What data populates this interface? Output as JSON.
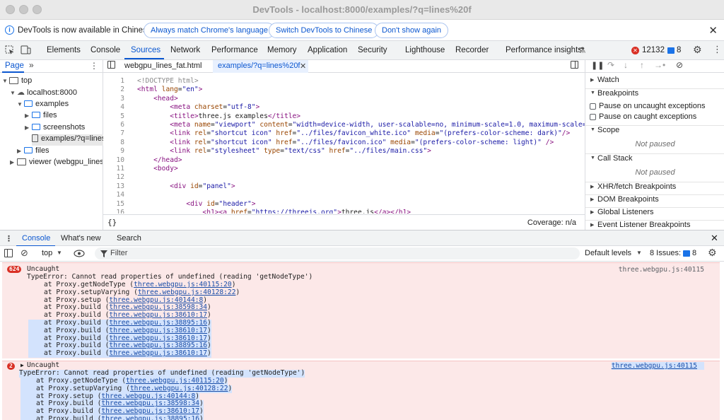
{
  "window": {
    "title": "DevTools - localhost:8000/examples/?q=lines%20f"
  },
  "infobar": {
    "message": "DevTools is now available in Chinese!",
    "btn_match": "Always match Chrome's language",
    "btn_switch": "Switch DevTools to Chinese",
    "btn_dont": "Don't show again",
    "close": "✕"
  },
  "tabs": {
    "elements": "Elements",
    "console": "Console",
    "sources": "Sources",
    "network": "Network",
    "performance": "Performance",
    "memory": "Memory",
    "application": "Application",
    "security": "Security",
    "lighthouse": "Lighthouse",
    "recorder": "Recorder",
    "perf_insights": "Performance insights",
    "error_count": "12132",
    "message_count": "8"
  },
  "navigator": {
    "tab_page": "Page",
    "items": [
      {
        "label": "top"
      },
      {
        "label": "localhost:8000"
      },
      {
        "label": "examples"
      },
      {
        "label": "files"
      },
      {
        "label": "screenshots"
      },
      {
        "label": "examples/?q=lines%20fat"
      },
      {
        "label": "files"
      },
      {
        "label": "viewer (webgpu_lines_fat.html)"
      }
    ]
  },
  "editor": {
    "tab1": "webgpu_lines_fat.html",
    "tab2": "examples/?q=lines%20f",
    "coverage": "Coverage: n/a",
    "format": "{}",
    "lines": [
      "<!DOCTYPE html>",
      "<html lang=\"en\">",
      "    <head>",
      "        <meta charset=\"utf-8\">",
      "        <title>three.js examples</title>",
      "        <meta name=\"viewport\" content=\"width=device-width, user-scalable=no, minimum-scale=1.0, maximum-scale=1.0\">",
      "        <link rel=\"shortcut icon\" href=\"../files/favicon_white.ico\" media=\"(prefers-color-scheme: dark)\"/>",
      "        <link rel=\"shortcut icon\" href=\"../files/favicon.ico\" media=\"(prefers-color-scheme: light)\" />",
      "        <link rel=\"stylesheet\" type=\"text/css\" href=\"../files/main.css\">",
      "    </head>",
      "    <body>",
      "",
      "        <div id=\"panel\">",
      "",
      "            <div id=\"header\">",
      "                <h1><a href=\"https://threejs.org\">three.js</a></h1>"
    ]
  },
  "debugger": {
    "watch": "Watch",
    "breakpoints": "Breakpoints",
    "pause_uncaught": "Pause on uncaught exceptions",
    "pause_caught": "Pause on caught exceptions",
    "scope": "Scope",
    "not_paused": "Not paused",
    "call_stack": "Call Stack",
    "not_paused2": "Not paused",
    "xhr": "XHR/fetch Breakpoints",
    "dom": "DOM Breakpoints",
    "global": "Global Listeners",
    "event": "Event Listener Breakpoints"
  },
  "drawer": {
    "console": "Console",
    "whats_new": "What's new",
    "search": "Search",
    "context": "top",
    "filter_placeholder": "Filter",
    "levels": "Default levels",
    "issues": "8 Issues:",
    "issues_count": "8"
  },
  "console": {
    "entries": [
      {
        "count": "624",
        "title": "Uncaught",
        "source": "three.webgpu.js:40115",
        "error": "TypeError: Cannot read properties of undefined (reading 'getNodeType')",
        "frames": [
          {
            "fn": "at Proxy.getNodeType (",
            "link": "three.webgpu.js:40115:20",
            "end": ")"
          },
          {
            "fn": "at Proxy.setupVarying (",
            "link": "three.webgpu.js:40128:22",
            "end": ")"
          },
          {
            "fn": "at Proxy.setup (",
            "link": "three.webgpu.js:40144:8",
            "end": ")"
          },
          {
            "fn": "at Proxy.build (",
            "link": "three.webgpu.js:38598:34",
            "end": ")"
          },
          {
            "fn": "at Proxy.build (",
            "link": "three.webgpu.js:38610:17",
            "end": ")"
          },
          {
            "fn": "at Proxy.build (",
            "link": "three.webgpu.js:38895:16",
            "end": ")"
          },
          {
            "fn": "at Proxy.build (",
            "link": "three.webgpu.js:38610:17",
            "end": ")"
          },
          {
            "fn": "at Proxy.build (",
            "link": "three.webgpu.js:38610:17",
            "end": ")"
          },
          {
            "fn": "at Proxy.build (",
            "link": "three.webgpu.js:38895:16",
            "end": ")"
          },
          {
            "fn": "at Proxy.build (",
            "link": "three.webgpu.js:38610:17",
            "end": ")"
          }
        ]
      },
      {
        "count": "2",
        "title": "Uncaught",
        "source": "three.webgpu.js:40115",
        "error": "TypeError: Cannot read properties of undefined (reading 'getNodeType')",
        "frames": [
          {
            "fn": "at Proxy.getNodeType (",
            "link": "three.webgpu.js:40115:20",
            "end": ")"
          },
          {
            "fn": "at Proxy.setupVarying (",
            "link": "three.webgpu.js:40128:22",
            "end": ")"
          },
          {
            "fn": "at Proxy.setup (",
            "link": "three.webgpu.js:40144:8",
            "end": ")"
          },
          {
            "fn": "at Proxy.build (",
            "link": "three.webgpu.js:38598:34",
            "end": ")"
          },
          {
            "fn": "at Proxy.build (",
            "link": "three.webgpu.js:38610:17",
            "end": ")"
          },
          {
            "fn": "at Proxy.build (",
            "link": "three.webgpu.js:38895:16",
            "end": ")"
          }
        ]
      }
    ]
  },
  "colors": {
    "accent": "#0b57d0",
    "error_bg": "#fce8e8",
    "error_badge": "#d93025",
    "highlight": "#d3e3fd"
  }
}
